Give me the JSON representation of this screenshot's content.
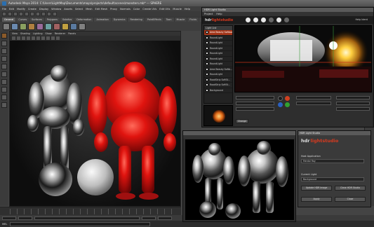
{
  "maya": {
    "title": "Autodesk Maya 2014: C:\\Users\\LightMap\\Documents\\maya\\projects\\default\\scenes\\monsters.mb* --- SPHERE",
    "menus": [
      "File",
      "Edit",
      "Modify",
      "Create",
      "Display",
      "Window",
      "Assets",
      "Select",
      "Mesh",
      "Edit Mesh",
      "Proxy",
      "Normals",
      "Color",
      "Create UVs",
      "Edit UVs",
      "Muscle",
      "Help"
    ],
    "shelf_tabs": [
      "General",
      "Curves",
      "Surfaces",
      "Polygons",
      "Subdivs",
      "Deformation",
      "Animation",
      "Dynamics",
      "Rendering",
      "PaintEffects",
      "Toon",
      "Muscle",
      "Fluids",
      "Fur",
      "Hair",
      "nCloth",
      "Custom"
    ],
    "active_shelf_tab": "General",
    "viewport_menus": [
      "View",
      "Shading",
      "Lighting",
      "Show",
      "Renderer",
      "Panels"
    ],
    "command_label": "MEL"
  },
  "hls": {
    "menus": [
      "Project",
      "Help"
    ],
    "logo_hdr": "hdr",
    "logo_light": "lightstudio",
    "help_label": "Help Ident",
    "light_list_header": "Light List",
    "lights": [
      {
        "name": "Area Beauty Softbox",
        "selected": true
      },
      {
        "name": "RoundLight",
        "selected": false
      },
      {
        "name": "RoundLight",
        "selected": false
      },
      {
        "name": "RoundLight",
        "selected": false
      },
      {
        "name": "RoundLight",
        "selected": false
      },
      {
        "name": "RoundLight",
        "selected": false
      },
      {
        "name": "RoundLight",
        "selected": false
      },
      {
        "name": "Area Beauty Softb...",
        "selected": false
      },
      {
        "name": "RoundLight",
        "selected": false
      },
      {
        "name": "RoadStrip SoftSt...",
        "selected": false
      },
      {
        "name": "RoadStrip SoftSt...",
        "selected": false
      },
      {
        "name": "Background",
        "selected": false
      }
    ],
    "change_button": "Change"
  },
  "dialog": {
    "title": "HDR Light Studio",
    "logo_hdr": "hdr",
    "logo_light": "lightstudio",
    "host_label": "Host Application",
    "host_value": "Mental Ray",
    "current_label": "Current Light",
    "current_value": "Background",
    "sync_button": "Update HDR Image",
    "live_button": "Close HDR Studio",
    "ok_button": "Apply",
    "cancel_button": "Close"
  }
}
